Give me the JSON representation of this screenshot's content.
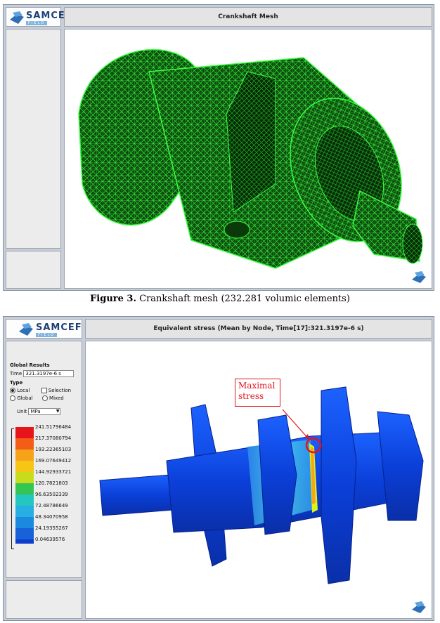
{
  "figure3": {
    "logo": {
      "name": "SAMCEF",
      "sub": "FIELD"
    },
    "view_title": "Crankshaft Mesh",
    "caption_label": "Figure 3.",
    "caption_text": " Crankshaft mesh (232.281 volumic elements)",
    "mesh_color": "#22d72a"
  },
  "figure4": {
    "logo": {
      "name": "SAMCEF",
      "sub": "FIELD"
    },
    "view_title": "Equivalent stress (Mean by Node, Time[17]:321.3197e-6 s)",
    "results": {
      "group_title": "Global Results",
      "time_label": "Time",
      "time_value": "321.3197e-6 s",
      "type_label": "Type",
      "options": {
        "local": "Local",
        "selection": "Selection",
        "global": "Global",
        "mixed": "Mixed"
      },
      "selected_option": "Local",
      "unit_label": "Unit",
      "unit_value": "MPa"
    },
    "legend": {
      "values": [
        "241.51796484",
        "217.37080794",
        "193.22365103",
        "169.07649412",
        "144.92933721",
        "120.7821803",
        "96.63502339",
        "72.48786649",
        "48.34070958",
        "24.19355267",
        "0.04639576"
      ],
      "colors": [
        "#e8141c",
        "#f25d18",
        "#f7a31a",
        "#f6c617",
        "#c9dc1c",
        "#34c653",
        "#24c6c0",
        "#27aee2",
        "#1b89df",
        "#1762d8",
        "#0d3ccf"
      ]
    },
    "annotation": "Maximal stress",
    "annotation_color": "#e3141c",
    "model_color": "#0b46e0"
  }
}
